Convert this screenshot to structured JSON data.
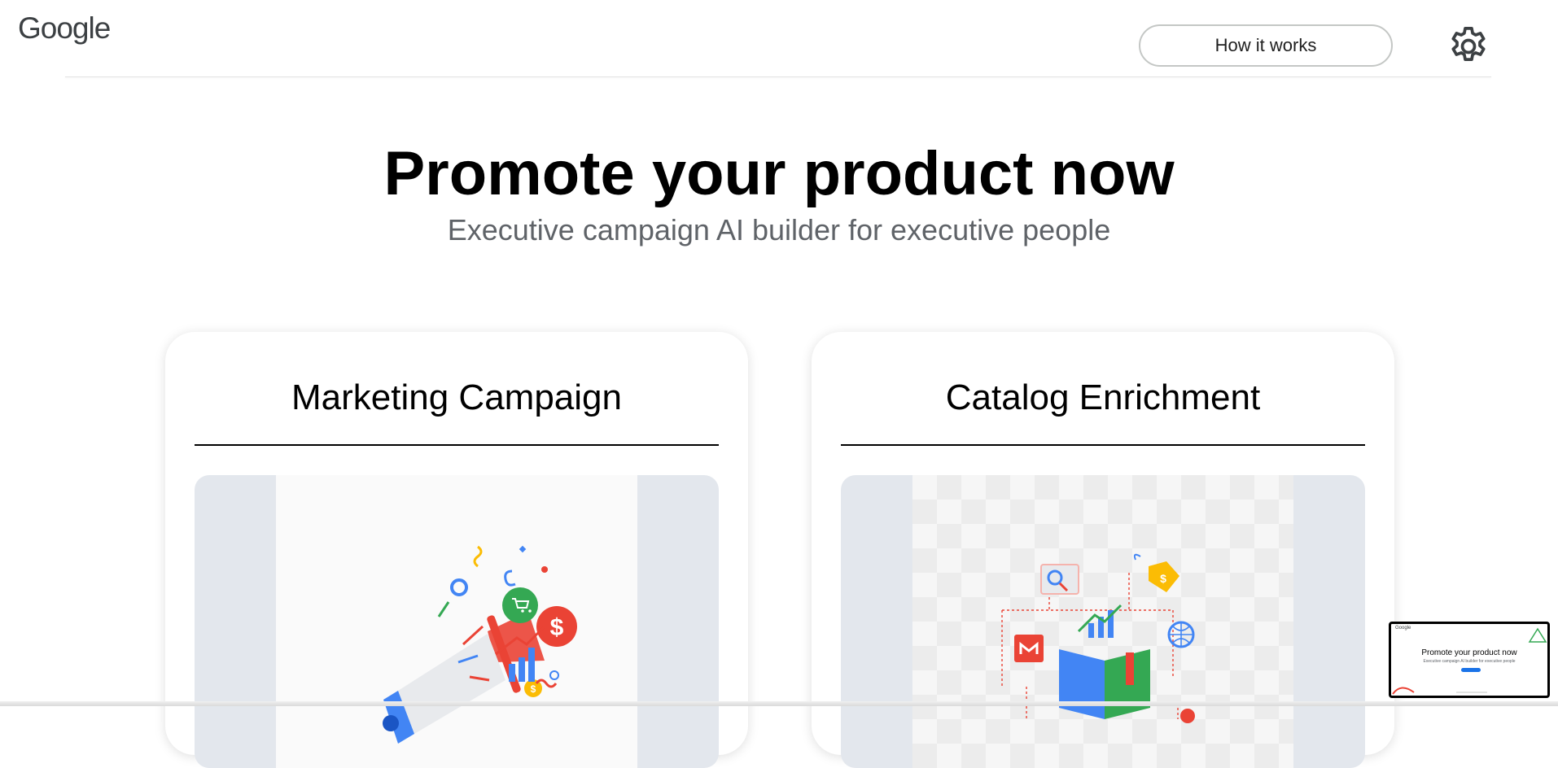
{
  "header": {
    "logo_text": "Google",
    "how_it_works_label": "How it works",
    "settings_icon": "gear-icon"
  },
  "hero": {
    "title": "Promote your product now",
    "subtitle": "Executive campaign AI builder for executive people"
  },
  "cards": [
    {
      "title": "Marketing Campaign",
      "illustration": "megaphone-illustration"
    },
    {
      "title": "Catalog Enrichment",
      "illustration": "catalog-book-illustration"
    }
  ],
  "preview_thumbnail": {
    "logo_text": "Google",
    "title": "Promote your product now",
    "subtitle": "Executive campaign AI builder for executive people"
  },
  "colors": {
    "blue": "#4285f4",
    "red": "#ea4335",
    "yellow": "#fbbc04",
    "green": "#34a853",
    "text_primary": "#000000",
    "text_secondary": "#5f6368"
  }
}
